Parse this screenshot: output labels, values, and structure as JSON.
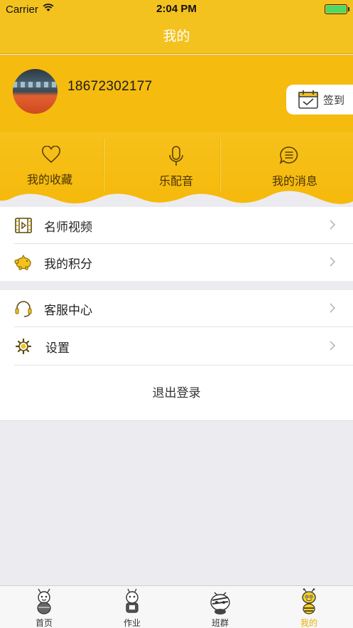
{
  "status_bar": {
    "carrier": "Carrier",
    "time": "2:04 PM"
  },
  "nav": {
    "title": "我的"
  },
  "profile": {
    "phone": "18672302177",
    "checkin_label": "签到"
  },
  "actions": [
    {
      "label": "我的收藏",
      "icon": "heart-icon"
    },
    {
      "label": "乐配音",
      "icon": "microphone-icon"
    },
    {
      "label": "我的消息",
      "icon": "message-icon"
    }
  ],
  "menu_section_1": [
    {
      "label": "名师视频",
      "icon": "film-icon"
    },
    {
      "label": "我的积分",
      "icon": "piggy-bank-icon"
    }
  ],
  "menu_section_2": [
    {
      "label": "客服中心",
      "icon": "headset-icon"
    },
    {
      "label": "设置",
      "icon": "gear-icon"
    }
  ],
  "logout_label": "退出登录",
  "tabs": [
    {
      "label": "首页",
      "icon": "bee-home-icon"
    },
    {
      "label": "作业",
      "icon": "bee-homework-icon"
    },
    {
      "label": "班群",
      "icon": "bee-class-icon"
    },
    {
      "label": "我的",
      "icon": "bee-me-icon"
    }
  ],
  "colors": {
    "accent": "#f4c21f",
    "active_tab": "#e8b100"
  }
}
